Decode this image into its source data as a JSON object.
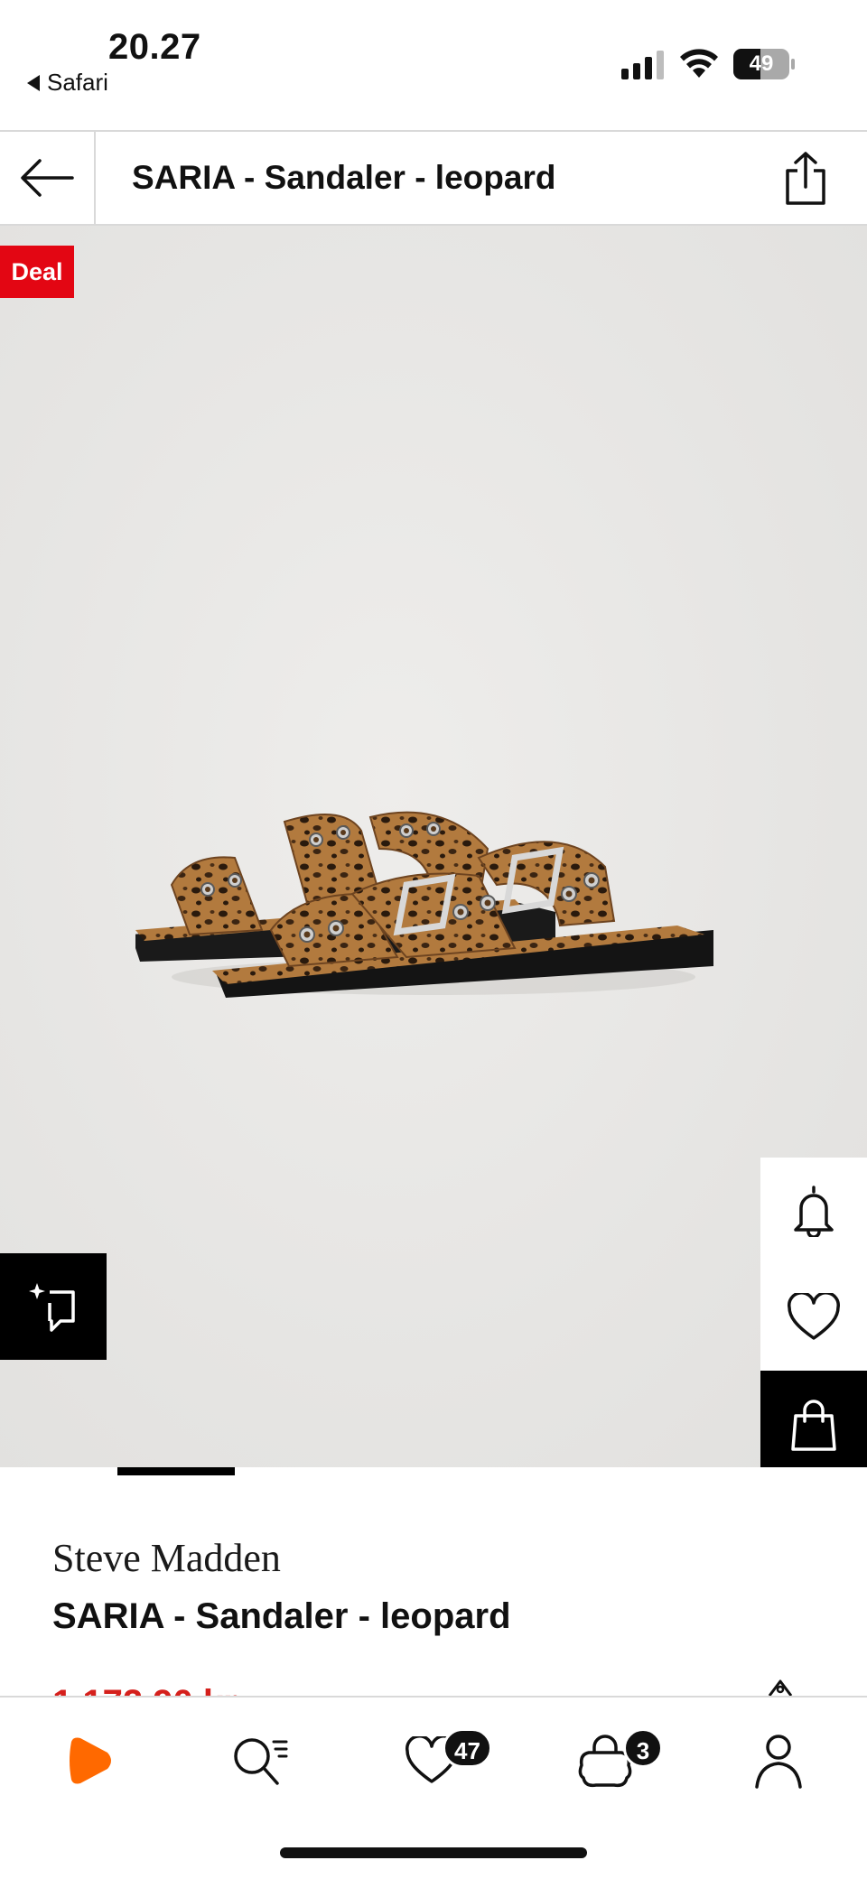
{
  "status_bar": {
    "time": "20.27",
    "back_app": "Safari",
    "battery_level": "49",
    "battery_fraction": 0.49
  },
  "header": {
    "title": "SARIA - Sandaler - leopard"
  },
  "gallery": {
    "deal_badge": "Deal",
    "image_index": 1,
    "image_count": 6
  },
  "product": {
    "brand": "Steve Madden",
    "name": "SARIA - Sandaler - leopard",
    "price_partial": "1 172,90 kr"
  },
  "tabbar": {
    "wishlist_count": "47",
    "cart_count": "3"
  },
  "colors": {
    "accent_red": "#e30613",
    "price_red": "#d5201c",
    "brand_orange": "#ff6900",
    "background_gallery": "#e7e6e4"
  },
  "icons": {
    "back": "arrow-left-icon",
    "share": "share-icon",
    "ai_compare": "sparkle-compare-icon",
    "notify": "bell-icon",
    "wishlist": "heart-icon",
    "add_to_cart": "shopping-bag-icon",
    "tab_home": "zalando-logo-icon",
    "tab_search": "search-icon",
    "tab_wishlist": "heart-icon",
    "tab_cart": "bag-icon",
    "tab_account": "user-icon"
  }
}
